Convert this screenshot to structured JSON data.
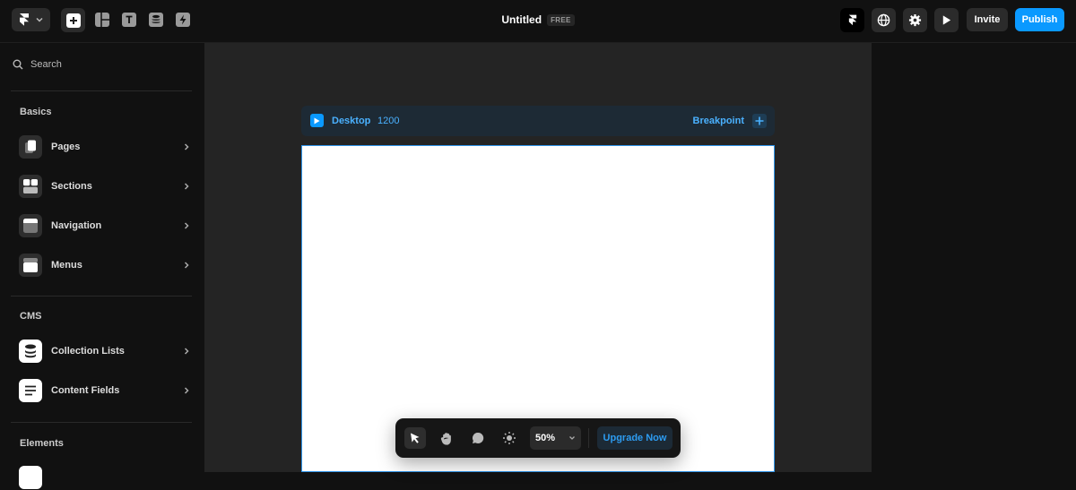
{
  "app": {
    "title": "Untitled",
    "plan_badge": "FREE"
  },
  "topbar": {
    "invite_label": "Invite",
    "publish_label": "Publish",
    "colors": {
      "accent": "#0a99ff"
    }
  },
  "sidebar": {
    "search_placeholder": "Search",
    "sections": [
      {
        "title": "Basics",
        "items": [
          {
            "label": "Pages",
            "icon": "pages-icon"
          },
          {
            "label": "Sections",
            "icon": "sections-icon"
          },
          {
            "label": "Navigation",
            "icon": "navigation-icon"
          },
          {
            "label": "Menus",
            "icon": "menus-icon"
          }
        ]
      },
      {
        "title": "CMS",
        "items": [
          {
            "label": "Collection Lists",
            "icon": "database-icon"
          },
          {
            "label": "Content Fields",
            "icon": "text-lines-icon"
          }
        ]
      },
      {
        "title": "Elements",
        "items": []
      }
    ]
  },
  "breakpoint_bar": {
    "device": "Desktop",
    "width": "1200",
    "add_label": "Breakpoint"
  },
  "bottom_toolbar": {
    "zoom": "50%",
    "upgrade_label": "Upgrade Now"
  }
}
